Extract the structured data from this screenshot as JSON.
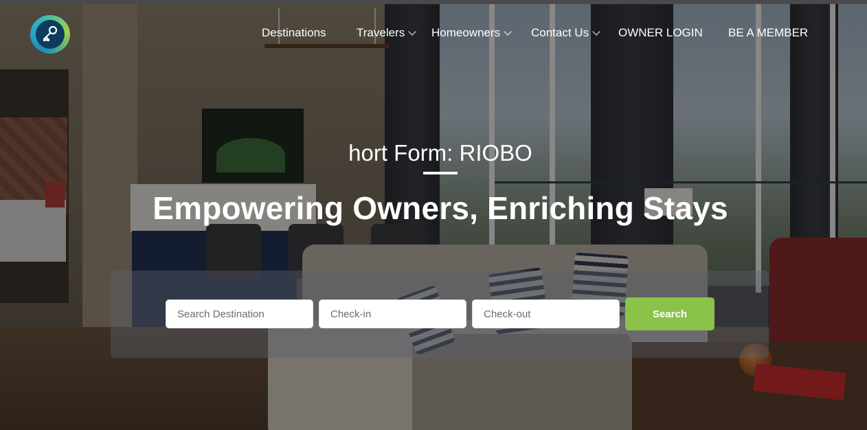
{
  "brand": {
    "logo_icon": "house-key-icon",
    "colors": {
      "accent_green": "#8bc34a",
      "logo_blue": "#1a8fb8",
      "logo_green": "#9cd24b"
    }
  },
  "nav": {
    "items": [
      {
        "label": "Destinations",
        "has_dropdown": false
      },
      {
        "label": "Travelers",
        "has_dropdown": true
      },
      {
        "label": "Homeowners",
        "has_dropdown": true
      },
      {
        "label": "Contact Us",
        "has_dropdown": true
      },
      {
        "label": "OWNER LOGIN",
        "has_dropdown": false
      },
      {
        "label": "BE A MEMBER",
        "has_dropdown": false
      }
    ]
  },
  "hero": {
    "subtitle": "hort Form: RIOBO",
    "headline": "Empowering Owners, Enriching Stays"
  },
  "search": {
    "destination_placeholder": "Search Destination",
    "checkin_placeholder": "Check-in",
    "checkout_placeholder": "Check-out",
    "button_label": "Search"
  }
}
